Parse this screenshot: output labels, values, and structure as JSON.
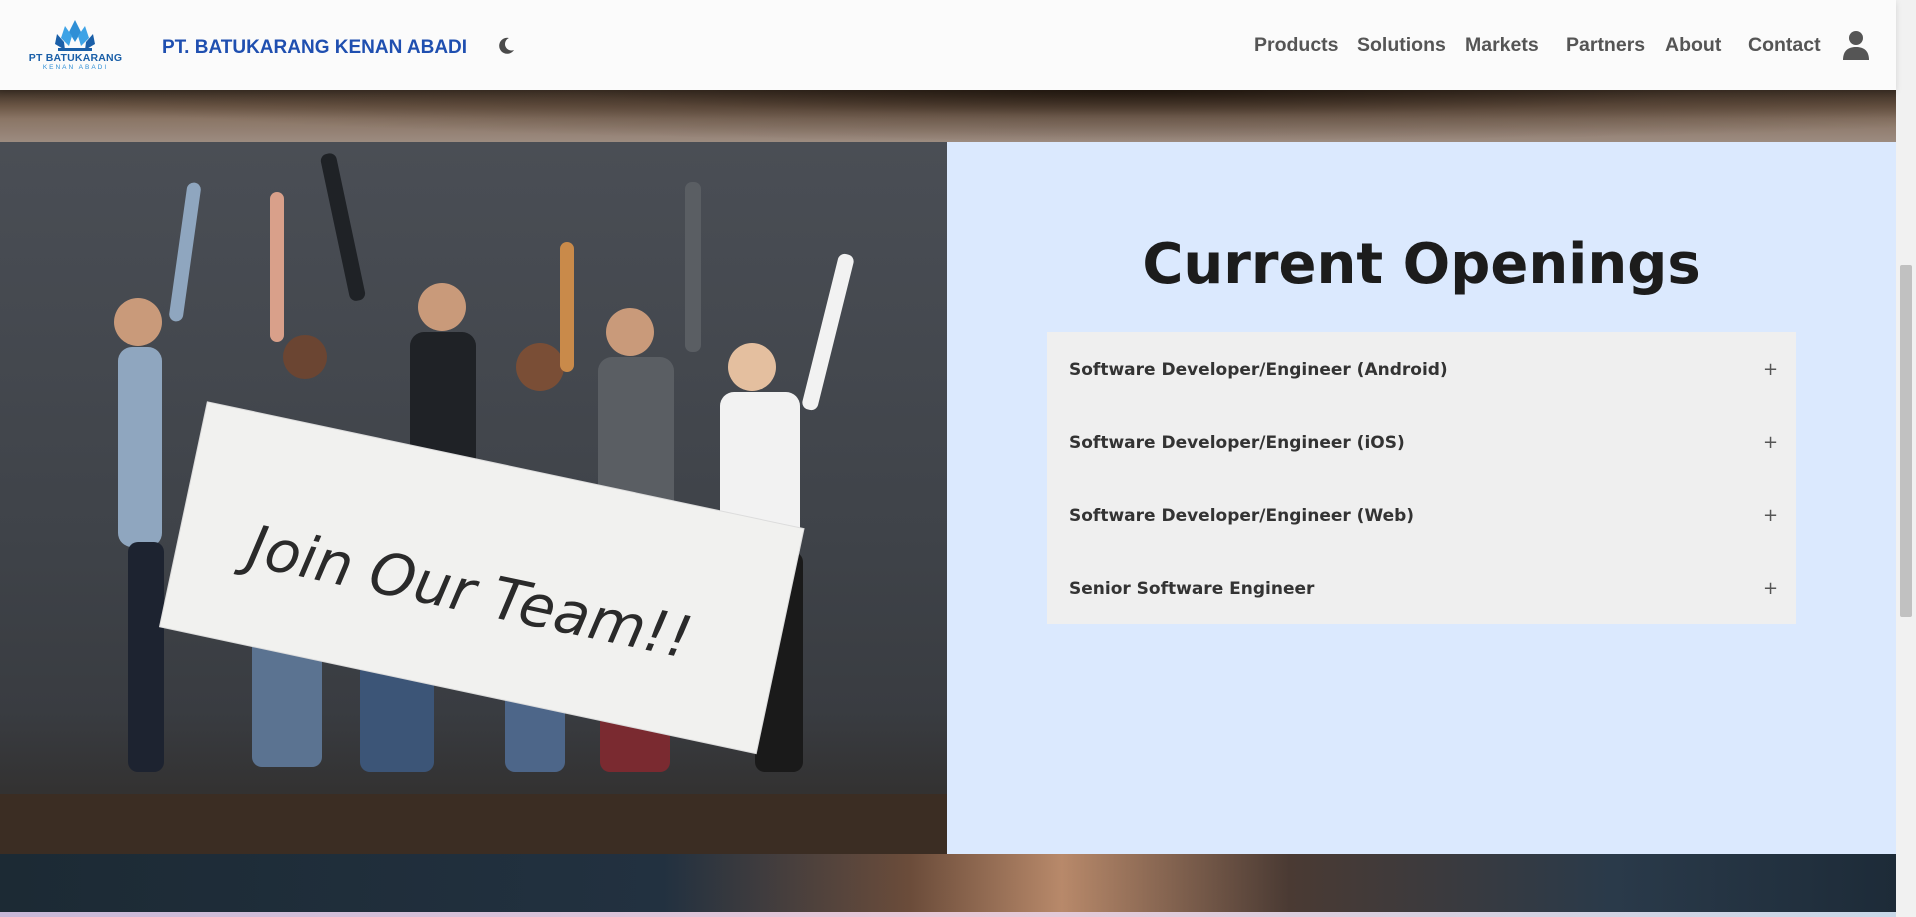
{
  "header": {
    "logo": {
      "line1": "PT BATUKARANG",
      "line2": "KENAN ABADI",
      "icon": "lotus-logo-icon"
    },
    "company_name": "PT. BATUKARANG KENAN ABADI",
    "theme_toggle_icon": "moon-icon",
    "nav": [
      "Products",
      "Solutions",
      "Markets",
      "Partners",
      "About",
      "Contact"
    ],
    "account_icon": "user-icon"
  },
  "photo": {
    "sign_text": "Join Our Team!!"
  },
  "openings": {
    "title": "Current Openings",
    "items": [
      {
        "label": "Software Developer/Engineer (Android)",
        "toggle": "+"
      },
      {
        "label": "Software Developer/Engineer (iOS)",
        "toggle": "+"
      },
      {
        "label": "Software Developer/Engineer (Web)",
        "toggle": "+"
      },
      {
        "label": "Senior Software Engineer",
        "toggle": "+"
      }
    ]
  },
  "colors": {
    "brand_blue": "#1f4fb0",
    "openings_bg": "#dbe9fe",
    "accordion_bg": "#efefef"
  }
}
